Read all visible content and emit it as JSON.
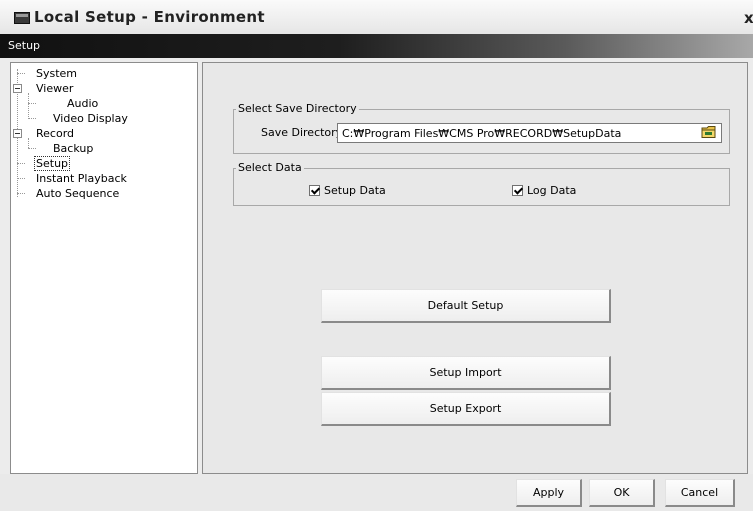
{
  "window": {
    "title": "Local Setup - Environment",
    "close_label": "x"
  },
  "header": {
    "title": "Setup"
  },
  "tree": {
    "items": [
      {
        "label": "System"
      },
      {
        "label": "Viewer"
      },
      {
        "label": "Audio"
      },
      {
        "label": "Video Display"
      },
      {
        "label": "Record"
      },
      {
        "label": "Backup"
      },
      {
        "label": "Setup"
      },
      {
        "label": "Instant Playback"
      },
      {
        "label": "Auto Sequence"
      }
    ],
    "selected": "Setup"
  },
  "save_directory": {
    "group_label": "Select Save Directory",
    "field_label": "Save Directory",
    "value": "C:\\Program Files\\CMS Pro\\RECORD\\SetupData",
    "display_value": "C:₩Program Files₩CMS Pro₩RECORD₩SetupData"
  },
  "select_data": {
    "group_label": "Select Data",
    "setup_data": {
      "label": "Setup Data",
      "checked": true
    },
    "log_data": {
      "label": "Log Data",
      "checked": true
    }
  },
  "buttons": {
    "default_setup": "Default Setup",
    "setup_import": "Setup Import",
    "setup_export": "Setup Export",
    "apply": "Apply",
    "ok": "OK",
    "cancel": "Cancel"
  }
}
